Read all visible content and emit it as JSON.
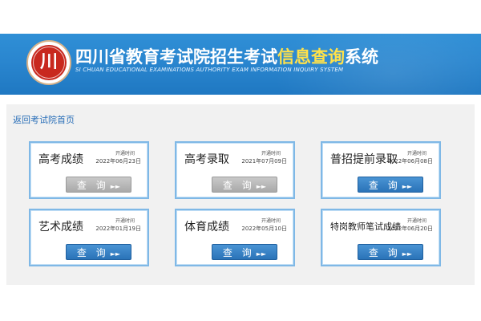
{
  "header": {
    "title_main": "四川省教育考试院招生考试",
    "title_highlight": "信息查询",
    "title_tail": "系统",
    "subtitle": "SI CHUAN EDUCATIONAL EXAMINATIONS AUTHORITY EXAM INFORMATION INQUIRY SYSTEM",
    "logo_glyph": "川"
  },
  "nav": {
    "back_link": "返回考试院首页"
  },
  "cards": [
    {
      "name": "高考成绩",
      "open_label": "开通时间",
      "date": "2022年06月23日",
      "button": "查 询",
      "arrow": "►►",
      "state": "disabled"
    },
    {
      "name": "高考录取",
      "open_label": "开通时间",
      "date": "2021年07月09日",
      "button": "查 询",
      "arrow": "►►",
      "state": "disabled"
    },
    {
      "name": "普招提前录取",
      "open_label": "开通时间",
      "date": "2022年06月08日",
      "button": "查 询",
      "arrow": "►►",
      "state": "active"
    },
    {
      "name": "艺术成绩",
      "open_label": "开通时间",
      "date": "2022年01月19日",
      "button": "查 询",
      "arrow": "►►",
      "state": "active"
    },
    {
      "name": "体育成绩",
      "open_label": "开通时间",
      "date": "2022年05月10日",
      "button": "查 询",
      "arrow": "►►",
      "state": "active"
    },
    {
      "name": "特岗教师笔试成绩",
      "open_label": "开通时间",
      "date": "2022年06月20日",
      "button": "查 询",
      "arrow": "►►",
      "state": "active"
    }
  ],
  "colors": {
    "banner_blue": "#2a86cf",
    "title_highlight": "#ffe14a",
    "button_active": "#2a73b8",
    "button_disabled": "#b4b4b4",
    "link": "#2a6fb8"
  }
}
